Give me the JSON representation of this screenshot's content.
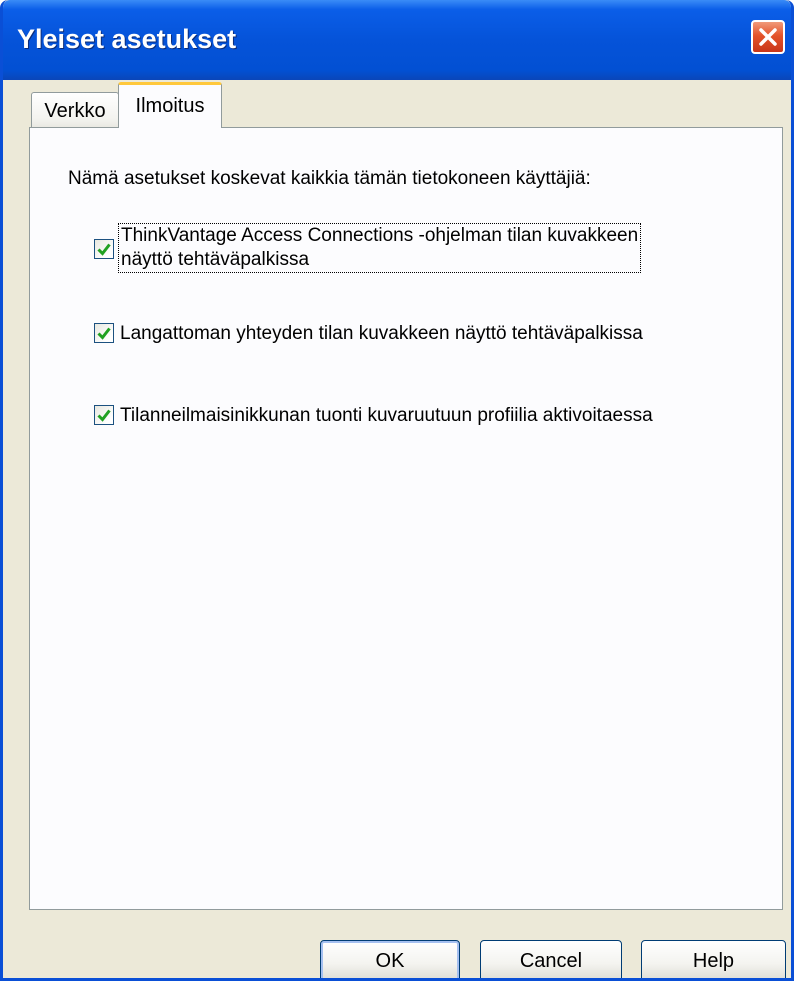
{
  "window": {
    "title": "Yleiset asetukset"
  },
  "tabs": [
    {
      "label": "Verkko",
      "active": false
    },
    {
      "label": "Ilmoitus",
      "active": true
    }
  ],
  "panel": {
    "intro": "Nämä asetukset koskevat kaikkia tämän tietokoneen käyttäjiä:",
    "checkboxes": [
      {
        "label_line1": "ThinkVantage Access Connections -ohjelman tilan kuvakkeen",
        "label_line2": "näyttö tehtäväpalkissa",
        "checked": true
      },
      {
        "label": "Langattoman yhteyden tilan kuvakkeen näyttö tehtäväpalkissa",
        "checked": true
      },
      {
        "label": "Tilanneilmaisinikkunan tuonti kuvaruutuun profiilia aktivoitaessa",
        "checked": true
      }
    ]
  },
  "buttons": {
    "ok": "OK",
    "cancel": "Cancel",
    "help": "Help"
  },
  "colors": {
    "titlebar": "#0553d9",
    "close": "#e4532a",
    "check": "#21a121",
    "dialog_bg": "#ece9d8"
  }
}
